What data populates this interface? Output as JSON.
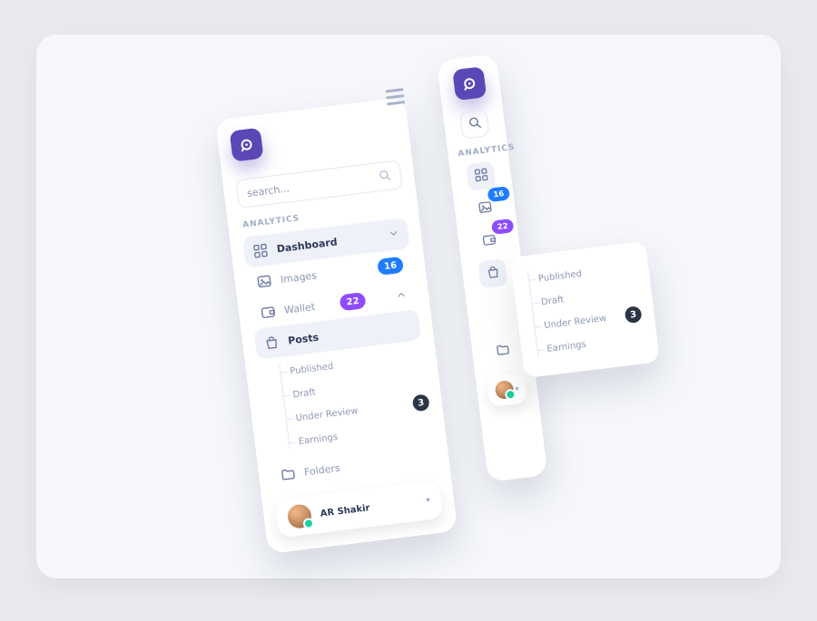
{
  "search": {
    "placeholder": "search..."
  },
  "section": {
    "analytics": "ANALYTICS"
  },
  "nav": {
    "dashboard": "Dashboard",
    "images": "Images",
    "wallet": "Wallet",
    "posts": "Posts",
    "folders": "Folders"
  },
  "badges": {
    "images": "16",
    "wallet": "22",
    "under_review": "3"
  },
  "sub": {
    "published": "Published",
    "draft": "Draft",
    "under_review": "Under Review",
    "earnings": "Earnings"
  },
  "user": {
    "name": "AR Shakir"
  },
  "colors": {
    "accent": "#5C47B7",
    "blue": "#1F7CFF",
    "violet": "#8E4BFF"
  }
}
